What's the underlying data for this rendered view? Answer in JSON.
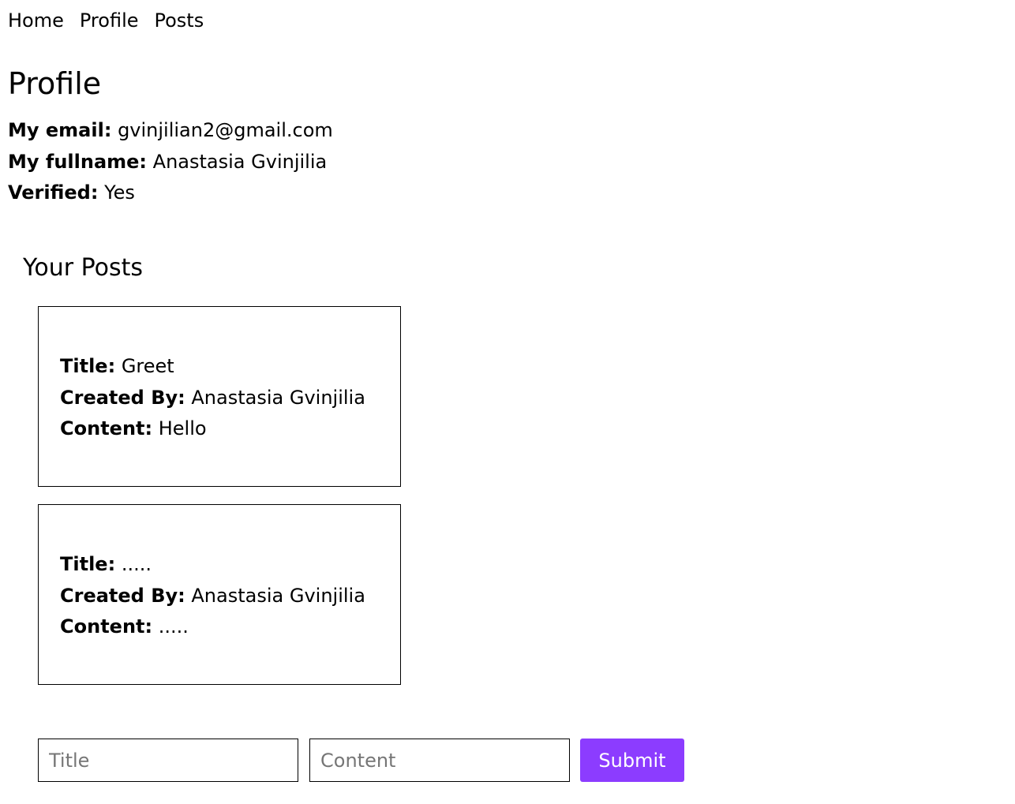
{
  "nav": {
    "items": [
      {
        "label": "Home"
      },
      {
        "label": "Profile"
      },
      {
        "label": "Posts"
      }
    ]
  },
  "page_title": "Profile",
  "profile": {
    "email_label": "My email:",
    "email": "gvinjilian2@gmail.com",
    "fullname_label": "My fullname:",
    "fullname": "Anastasia Gvinjilia",
    "verified_label": "Verified:",
    "verified": "Yes"
  },
  "posts_section": {
    "title": "Your Posts",
    "title_label": "Title:",
    "created_by_label": "Created By:",
    "content_label": "Content:",
    "posts": [
      {
        "title": "Greet",
        "created_by": "Anastasia Gvinjilia",
        "content": "Hello"
      },
      {
        "title": ".....",
        "created_by": "Anastasia Gvinjilia",
        "content": "....."
      }
    ]
  },
  "form": {
    "title_placeholder": "Title",
    "title_value": "",
    "content_placeholder": "Content",
    "content_value": "",
    "submit_label": "Submit",
    "submit_color": "#8c3cff"
  }
}
